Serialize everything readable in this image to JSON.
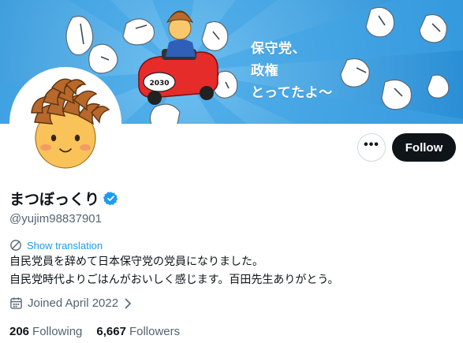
{
  "banner": {
    "lines": [
      "保守党、",
      "政権",
      "とってたよ〜"
    ],
    "car_plate": "2030"
  },
  "profile": {
    "display_name": "まつぼっくり",
    "handle": "@yujim98837901",
    "verified": true
  },
  "actions": {
    "more_label": "•••",
    "follow_label": "Follow"
  },
  "translation": {
    "label": "Show translation"
  },
  "bio": {
    "lines": [
      "自民党員を辞めて日本保守党の党員になりました。",
      "自民党時代よりごはんがおいしく感じます。百田先生ありがとう。"
    ]
  },
  "joined": {
    "label": "Joined April 2022"
  },
  "stats": {
    "following_count": "206",
    "following_label": "Following",
    "followers_count": "6,667",
    "followers_label": "Followers"
  },
  "colors": {
    "accent": "#1d9bf0",
    "follow_bg": "#0f1419",
    "muted": "#536471",
    "banner_blue": "#2a8fd6"
  }
}
